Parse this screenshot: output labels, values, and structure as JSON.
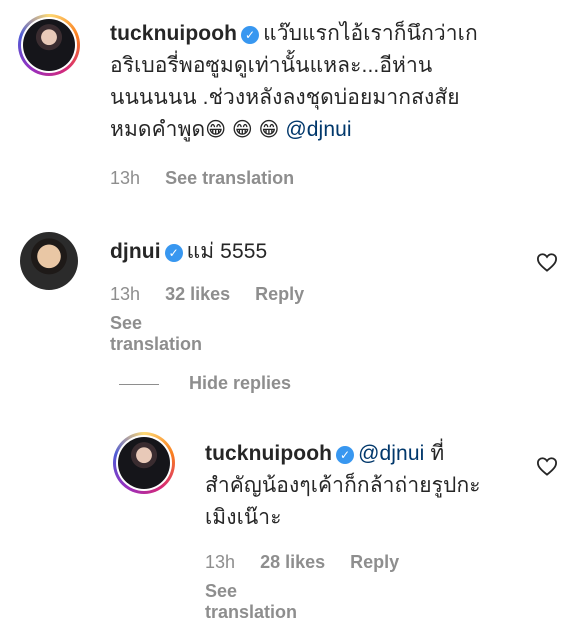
{
  "comments": [
    {
      "username": "tucknuipooh",
      "verified": true,
      "text_lines": [
        "แว๊บแรกไอ้เราก็นึกว่าเก",
        "อริเบอรี่พอซูมดูเท่านั้นแหละ...อีห่าน",
        "นนนนนน .ช่วงหลังลงชุดบ่อยมากสงสัย",
        "หมดคำพูด"
      ],
      "emojis": "😁 😁 😁",
      "mention": "@djnui",
      "time": "13h",
      "see_translation": "See translation"
    },
    {
      "username": "djnui",
      "verified": true,
      "text": "แม่ 5555",
      "time": "13h",
      "likes": "32 likes",
      "reply": "Reply",
      "see_translation": "See translation"
    }
  ],
  "hide_replies": "Hide replies",
  "reply": {
    "username": "tucknuipooh",
    "verified": true,
    "mention": "@djnui",
    "text_first": "ที่",
    "text_lines": [
      "สำคัญน้องๆเค้าก็กล้าถ่ายรูปกะ",
      "เมิงเน๊าะ"
    ],
    "time": "13h",
    "likes": "28 likes",
    "reply_label": "Reply",
    "see_translation": "See translation"
  },
  "icons": {
    "verified": "verified-check-icon",
    "like": "heart-outline-icon"
  },
  "colors": {
    "verified": "#3897f0",
    "mention": "#00376b",
    "meta": "#8e8e8e"
  }
}
